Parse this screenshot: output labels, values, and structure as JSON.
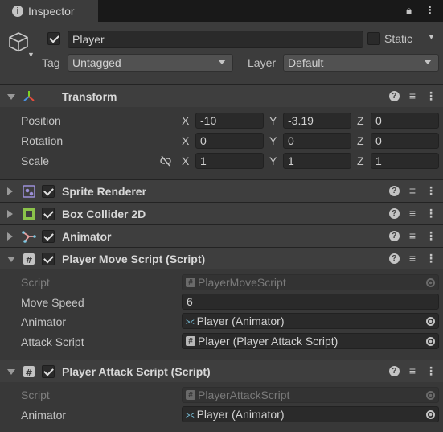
{
  "tab": {
    "title": "Inspector"
  },
  "object": {
    "name": "Player",
    "active": true,
    "static_label": "Static",
    "tag_label": "Tag",
    "tag_value": "Untagged",
    "layer_label": "Layer",
    "layer_value": "Default"
  },
  "transform": {
    "title": "Transform",
    "rows": [
      {
        "label": "Position",
        "x": "-10",
        "y": "-3.19",
        "z": "0"
      },
      {
        "label": "Rotation",
        "x": "0",
        "y": "0",
        "z": "0"
      },
      {
        "label": "Scale",
        "x": "1",
        "y": "1",
        "z": "1"
      }
    ],
    "axes": [
      "X",
      "Y",
      "Z"
    ]
  },
  "components": [
    {
      "title": "Sprite Renderer",
      "icon": "sprite-renderer-icon"
    },
    {
      "title": "Box Collider 2D",
      "icon": "box-collider-icon"
    },
    {
      "title": "Animator",
      "icon": "animator-icon"
    }
  ],
  "move_script": {
    "title": "Player Move Script (Script)",
    "script_label": "Script",
    "script_value": "PlayerMoveScript",
    "speed_label": "Move Speed",
    "speed_value": "6",
    "animator_label": "Animator",
    "animator_value": "Player (Animator)",
    "attack_label": "Attack Script",
    "attack_value": "Player (Player Attack Script)"
  },
  "attack_script": {
    "title": "Player Attack Script (Script)",
    "script_label": "Script",
    "script_value": "PlayerAttackScript",
    "animator_label": "Animator",
    "animator_value": "Player (Animator)"
  },
  "colors": {
    "background": "#383838",
    "header": "#3e3e3e",
    "field": "#2a2a2a",
    "tabbar": "#191919"
  }
}
